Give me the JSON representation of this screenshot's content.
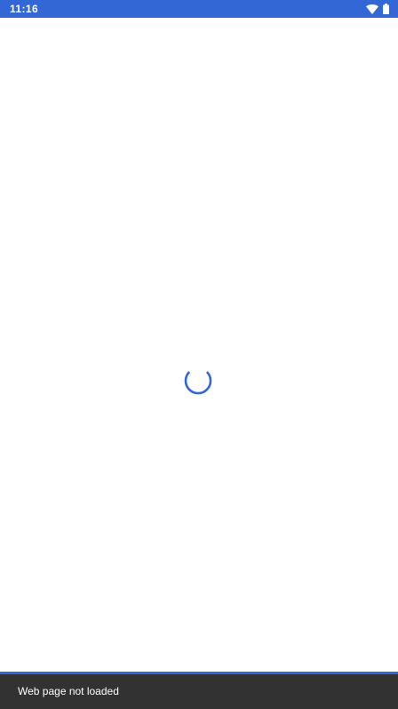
{
  "status_bar": {
    "time": "11:16",
    "icons": [
      "wifi-icon",
      "battery-icon"
    ],
    "background_color": "#3367d6"
  },
  "content": {
    "loading_indicator": "loading-spinner-icon",
    "spinner_color": "#3367d6"
  },
  "snackbar": {
    "message": "Web page not loaded",
    "background_color": "#323232"
  }
}
